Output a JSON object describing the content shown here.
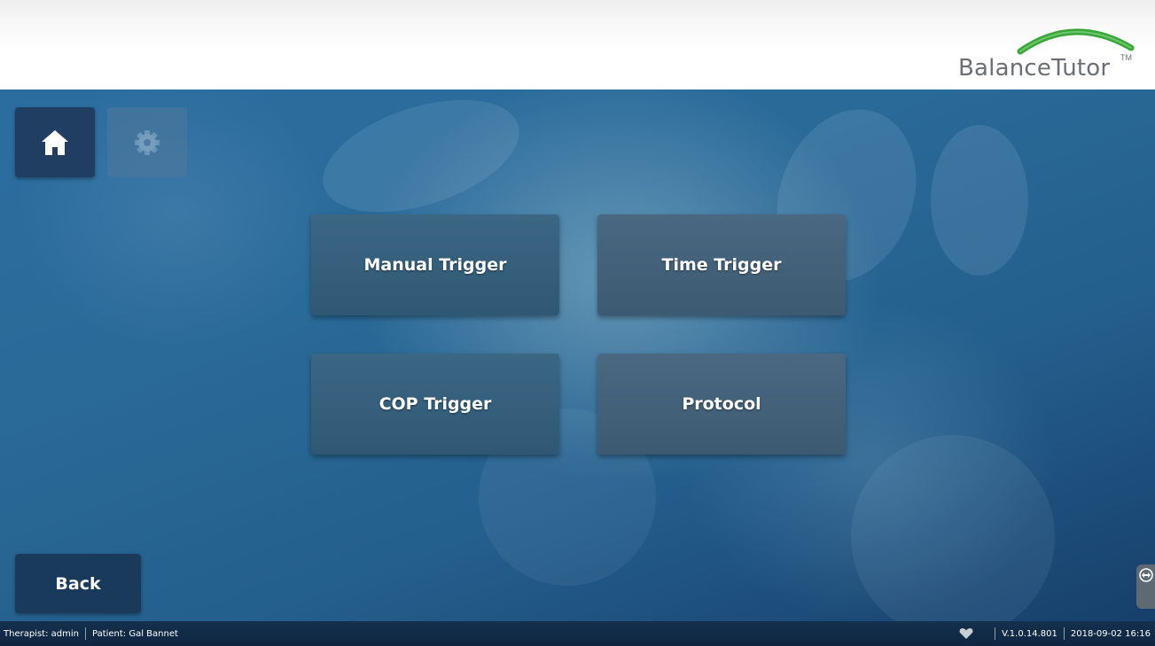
{
  "header": {
    "logo_text": "BalanceTutor",
    "logo_tm": "TM"
  },
  "nav": {
    "home_icon": "home-icon",
    "settings_icon": "gear-icon"
  },
  "menu": {
    "manual_trigger": "Manual Trigger",
    "time_trigger": "Time Trigger",
    "cop_trigger": "COP Trigger",
    "protocol": "Protocol"
  },
  "back_label": "Back",
  "status": {
    "therapist": "Therapist: admin",
    "patient": "Patient: Gal Bannet",
    "heart_icon": "heart-icon",
    "version": "V.1.0.14.801",
    "datetime": "2018-09-02 16:16"
  },
  "colors": {
    "accent_green": "#3aa63a",
    "home_button": "#1f3e61",
    "status_bar": "#14304d"
  }
}
